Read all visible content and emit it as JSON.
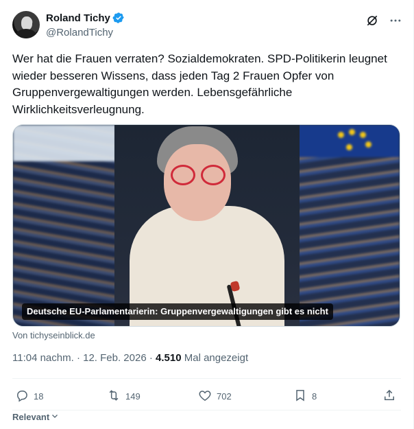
{
  "author": {
    "display_name": "Roland Tichy",
    "handle": "@RolandTichy",
    "verified_color": "#1d9bf0"
  },
  "tweet": {
    "text": "Wer hat die Frauen verraten? Sozialdemokraten. SPD-Politikerin leugnet wieder besseren Wissens, dass jeden Tag 2 Frauen Opfer von Gruppenvergewaltigungen werden. Lebensgefährliche Wirklichkeitsverleugnung."
  },
  "media": {
    "caption": "Deutsche EU-Parlamentarierin: Gruppenvergewaltigungen gibt es nicht",
    "source": "Von tichyseinblick.de"
  },
  "meta": {
    "time_date": "11:04 nachm. · 12. Feb. 2026 · ",
    "views": "4.510",
    "views_label": " Mal angezeigt"
  },
  "actions": {
    "replies": "18",
    "retweets": "149",
    "likes": "702",
    "bookmarks": "8"
  },
  "footer": {
    "sort_label": "Relevant"
  },
  "icons": {
    "grok": "grok-icon",
    "more": "more-icon",
    "reply": "reply-icon",
    "retweet": "retweet-icon",
    "like": "heart-icon",
    "bookmark": "bookmark-icon",
    "share": "share-icon"
  }
}
